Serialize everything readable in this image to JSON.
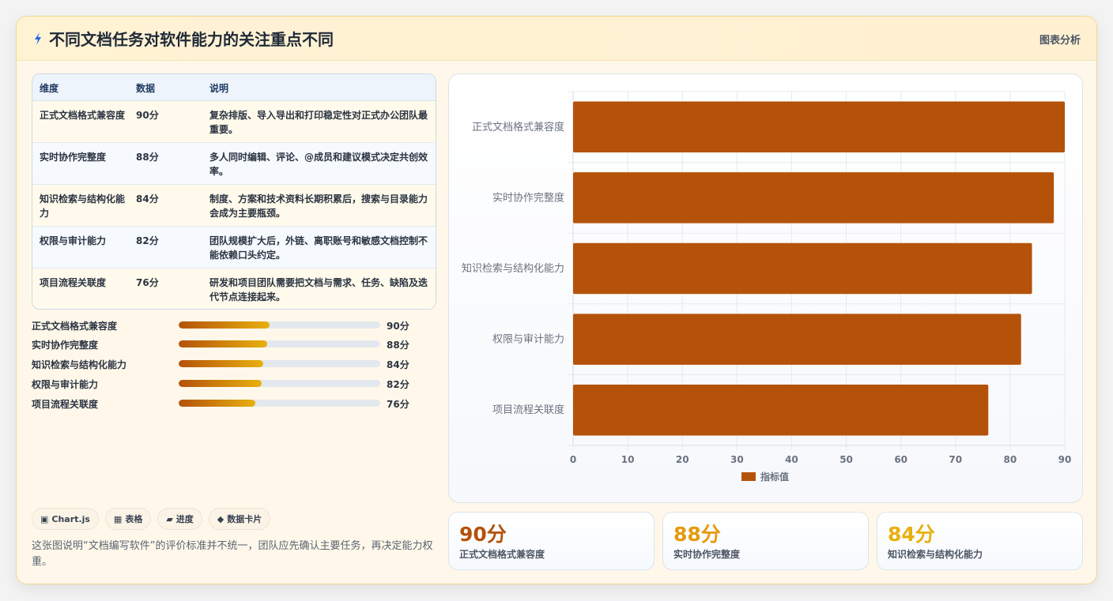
{
  "header": {
    "title": "不同文档任务对软件能力的关注重点不同",
    "link": "图表分析",
    "icon": "bolt-icon",
    "icon_color": "#2563eb"
  },
  "table": {
    "columns": [
      "维度",
      "数据",
      "说明"
    ],
    "rows": [
      {
        "dim": "正式文档格式兼容度",
        "val": "90分",
        "desc": "复杂排版、导入导出和打印稳定性对正式办公团队最重要。"
      },
      {
        "dim": "实时协作完整度",
        "val": "88分",
        "desc": "多人同时编辑、评论、@成员和建议模式决定共创效率。"
      },
      {
        "dim": "知识检索与结构化能力",
        "val": "84分",
        "desc": "制度、方案和技术资料长期积累后，搜索与目录能力会成为主要瓶颈。"
      },
      {
        "dim": "权限与审计能力",
        "val": "82分",
        "desc": "团队规模扩大后，外链、离职账号和敏感文档控制不能依赖口头约定。"
      },
      {
        "dim": "项目流程关联度",
        "val": "76分",
        "desc": "研发和项目团队需要把文档与需求、任务、缺陷及迭代节点连接起来。"
      }
    ]
  },
  "progress": {
    "max": 200,
    "items": [
      {
        "label": "正式文档格式兼容度",
        "value": 90,
        "text": "90分"
      },
      {
        "label": "实时协作完整度",
        "value": 88,
        "text": "88分"
      },
      {
        "label": "知识检索与结构化能力",
        "value": 84,
        "text": "84分"
      },
      {
        "label": "权限与审计能力",
        "value": 82,
        "text": "82分"
      },
      {
        "label": "项目流程关联度",
        "value": 76,
        "text": "76分"
      }
    ]
  },
  "tags": [
    {
      "icon": "▣",
      "label": "Chart.js"
    },
    {
      "icon": "▦",
      "label": "表格"
    },
    {
      "icon": "▰",
      "label": "进度"
    },
    {
      "icon": "◆",
      "label": "数据卡片"
    }
  ],
  "note": "这张图说明“文档编写软件”的评价标准并不统一，团队应先确认主要任务，再决定能力权重。",
  "chart_data": {
    "type": "bar",
    "orientation": "horizontal",
    "categories": [
      "正式文档格式兼容度",
      "实时协作完整度",
      "知识检索与结构化能力",
      "权限与审计能力",
      "项目流程关联度"
    ],
    "series": [
      {
        "name": "指标值",
        "values": [
          90,
          88,
          84,
          82,
          76
        ],
        "color": "#b5520a"
      }
    ],
    "xlim": [
      0,
      90
    ],
    "xticks": [
      0,
      10,
      20,
      30,
      40,
      50,
      60,
      70,
      80,
      90
    ],
    "grid": true,
    "legend": "bottom",
    "title": "",
    "xlabel": "",
    "ylabel": ""
  },
  "stats": [
    {
      "value": "90分",
      "label": "正式文档格式兼容度",
      "color": "#b5520a"
    },
    {
      "value": "88分",
      "label": "实时协作完整度",
      "color": "#e59a0c"
    },
    {
      "value": "84分",
      "label": "知识检索与结构化能力",
      "color": "#e8b00f"
    }
  ]
}
